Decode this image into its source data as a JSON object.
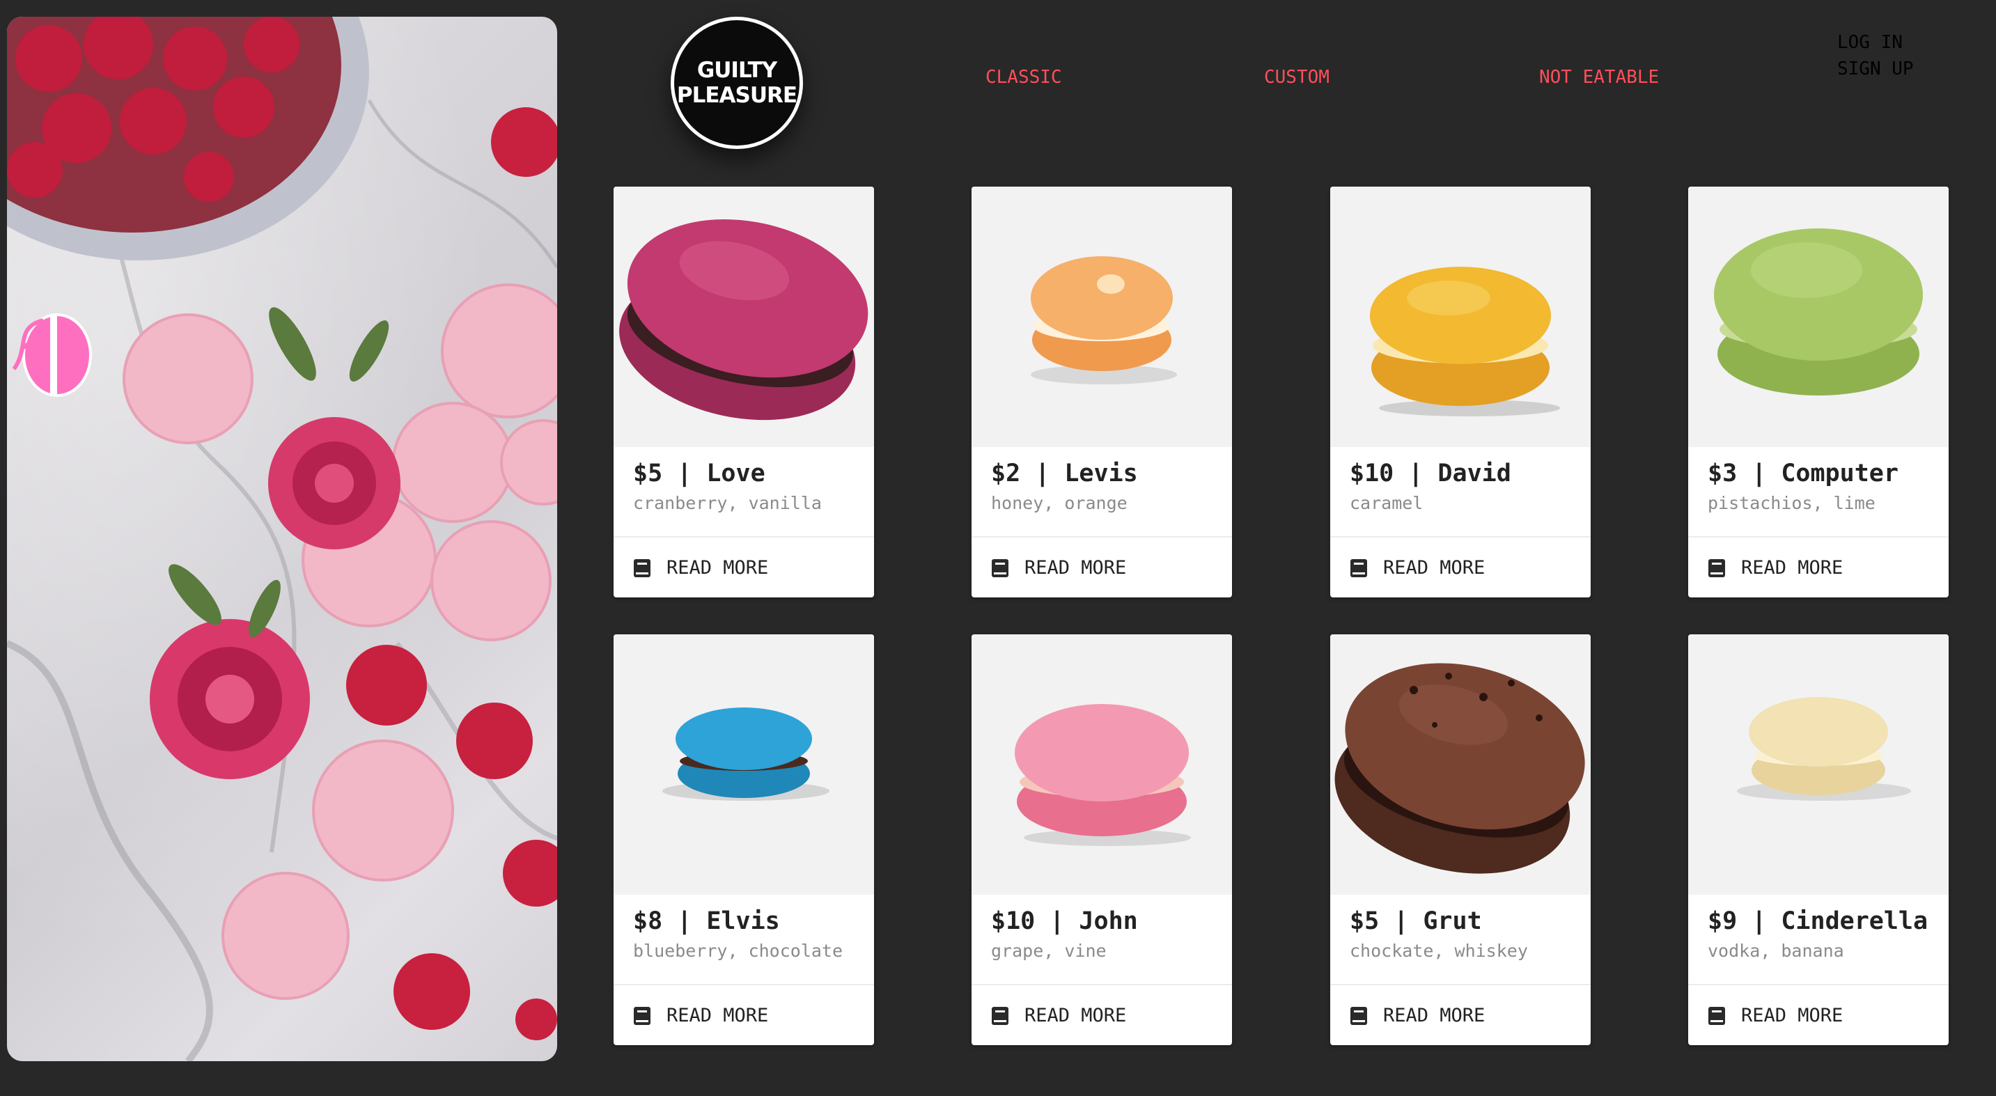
{
  "logo": {
    "line1": "GUILTY",
    "line2": "PLEASURE"
  },
  "nav": {
    "classic": "CLASSIC",
    "custom": "CUSTOM",
    "not_eatable": "NOT EATABLE",
    "login": "LOG IN",
    "signup": "SIGN UP"
  },
  "colors": {
    "background": "#282828",
    "nav_link": "#ff4f5a",
    "card": "#ffffff",
    "card_image_bg": "#f2f2f2"
  },
  "hero_image": "macarons-raspberries-roses-on-marble",
  "products": [
    {
      "title": "$5 | Love",
      "flavors": "cranberry, vanilla",
      "action": "READ MORE",
      "icon": "book-icon",
      "macaron_color": "#b4386a"
    },
    {
      "title": "$2 | Levis",
      "flavors": "honey, orange",
      "action": "READ MORE",
      "icon": "book-icon",
      "macaron_color": "#f3a45e"
    },
    {
      "title": "$10 | David",
      "flavors": "caramel",
      "action": "READ MORE",
      "icon": "book-icon",
      "macaron_color": "#efb52e"
    },
    {
      "title": "$3 | Computer",
      "flavors": "pistachios, lime",
      "action": "READ MORE",
      "icon": "book-icon",
      "macaron_color": "#a6c563"
    },
    {
      "title": "$8 | Elvis",
      "flavors": "blueberry, chocolate",
      "action": "READ MORE",
      "icon": "book-icon",
      "macaron_color": "#2a9ccd"
    },
    {
      "title": "$10 | John",
      "flavors": "grape, vine",
      "action": "READ MORE",
      "icon": "book-icon",
      "macaron_color": "#ef91a6"
    },
    {
      "title": "$5 | Grut",
      "flavors": "chockate, whiskey",
      "action": "READ MORE",
      "icon": "book-icon",
      "macaron_color": "#6e3b2a"
    },
    {
      "title": "$9 | Cinderella",
      "flavors": "vodka, banana",
      "action": "READ MORE",
      "icon": "book-icon",
      "macaron_color": "#efe0b2"
    }
  ]
}
